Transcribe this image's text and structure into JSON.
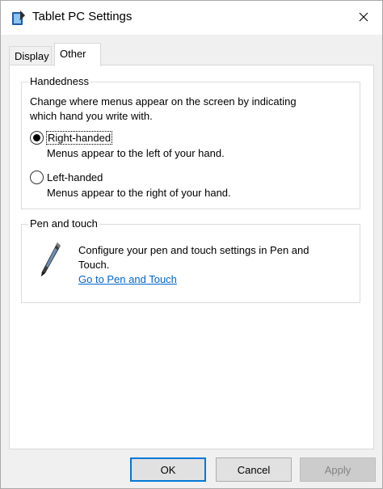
{
  "window": {
    "title": "Tablet PC Settings"
  },
  "tabs": [
    {
      "label": "Display"
    },
    {
      "label": "Other"
    }
  ],
  "handedness": {
    "legend": "Handedness",
    "description_line1": "Change where menus appear on the screen by indicating",
    "description_line2": "which hand you write with.",
    "options": [
      {
        "label": "Right-handed",
        "hint": "Menus appear to the left of your hand.",
        "selected": true
      },
      {
        "label": "Left-handed",
        "hint": "Menus appear to the right of your hand.",
        "selected": false
      }
    ]
  },
  "pen_touch": {
    "legend": "Pen and touch",
    "description_line1": "Configure your pen and touch settings in Pen and",
    "description_line2": "Touch.",
    "link": "Go to Pen and Touch",
    "icon": "pen-icon"
  },
  "buttons": {
    "ok": "OK",
    "cancel": "Cancel",
    "apply": "Apply"
  },
  "colors": {
    "link": "#0066cc",
    "default_button_border": "#0078d7"
  }
}
